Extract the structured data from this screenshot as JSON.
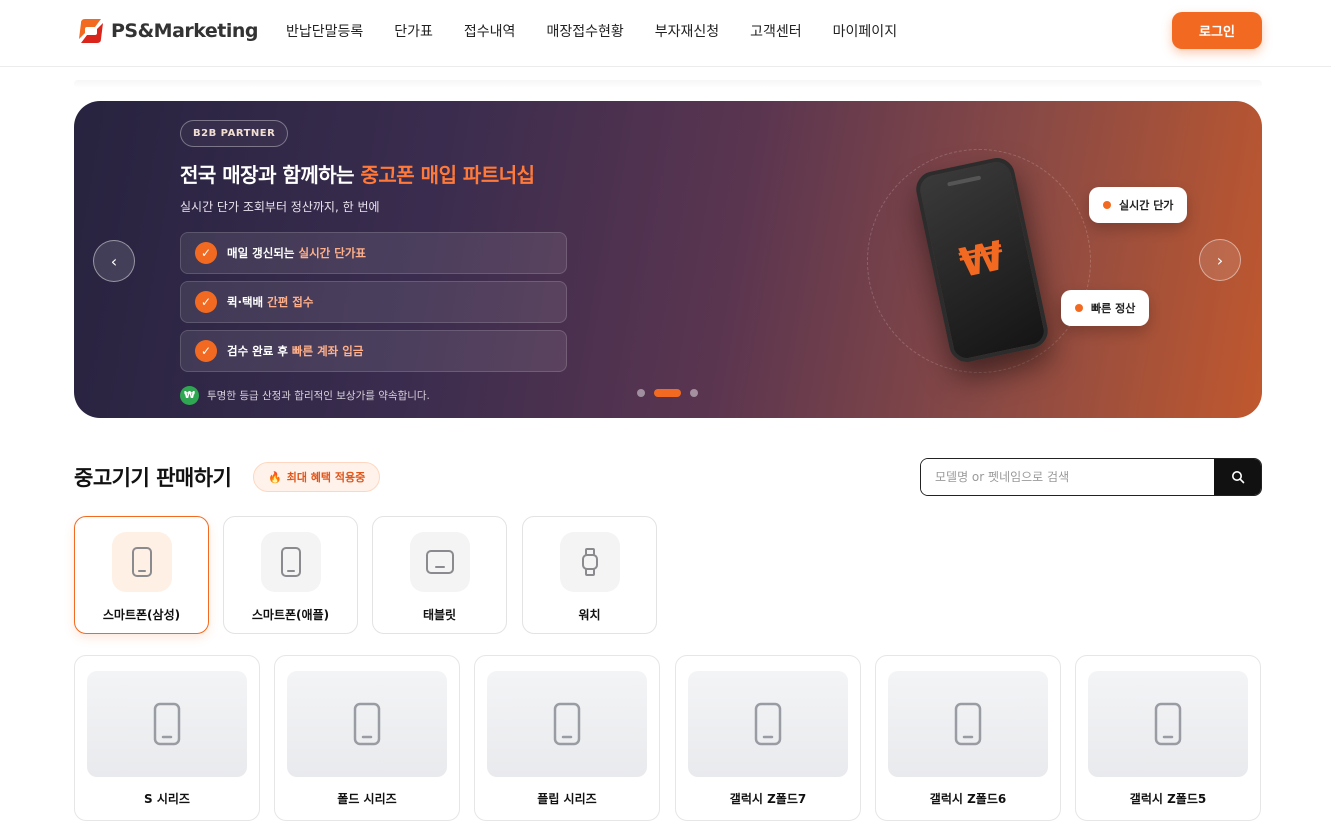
{
  "header": {
    "logo_text": "PS&Marketing",
    "nav": [
      "반납단말등록",
      "단가표",
      "접수내역",
      "매장접수현황",
      "부자재신청",
      "고객센터",
      "마이페이지"
    ],
    "login_label": "로그인"
  },
  "banner": {
    "pill": "B2B PARTNER",
    "title_prefix": "전국 매장과 함께하는 ",
    "title_highlight": "중고폰 매입 파트너십",
    "subtitle": "실시간 단가 조회부터 정산까지, 한 번에",
    "features": [
      {
        "prefix": "매일 갱신되는 ",
        "highlight": "실시간 단가표"
      },
      {
        "prefix": "퀵·택배 ",
        "highlight": "간편 접수"
      },
      {
        "prefix": "검수 완료 후 ",
        "highlight": "빠른 계좌 입금"
      }
    ],
    "footnote_badge": "₩",
    "footnote": "투명한 등급 산정과 합리적인 보상가를 약속합니다.",
    "prev_arrow": "‹",
    "next_arrow": "›",
    "phone_symbol": "₩",
    "chip_realtime": "실시간 단가",
    "chip_fast": "빠른 정산",
    "slide_count": 3,
    "active_slide": 2
  },
  "section": {
    "title": "중고기기 판매하기",
    "promo_icon": "🔥",
    "promo": "최대 혜택 적용중"
  },
  "search": {
    "placeholder": "모델명 or 펫네임으로 검색",
    "value": "",
    "button_icon": "search-icon"
  },
  "categories": [
    {
      "label": "스마트폰(삼성)",
      "icon": "smartphone-icon",
      "active": true
    },
    {
      "label": "스마트폰(애플)",
      "icon": "smartphone-icon",
      "active": false
    },
    {
      "label": "태블릿",
      "icon": "tablet-icon",
      "active": false
    },
    {
      "label": "워치",
      "icon": "watch-icon",
      "active": false
    }
  ],
  "products": [
    {
      "label": "S 시리즈"
    },
    {
      "label": "폴드 시리즈"
    },
    {
      "label": "플립 시리즈"
    },
    {
      "label": "갤럭시 Z폴드7"
    },
    {
      "label": "갤럭시 Z폴드6"
    },
    {
      "label": "갤럭시 Z폴드5"
    }
  ],
  "colors": {
    "accent": "#f26a21",
    "banner_start": "#27233f",
    "banner_end": "#c0582e"
  }
}
